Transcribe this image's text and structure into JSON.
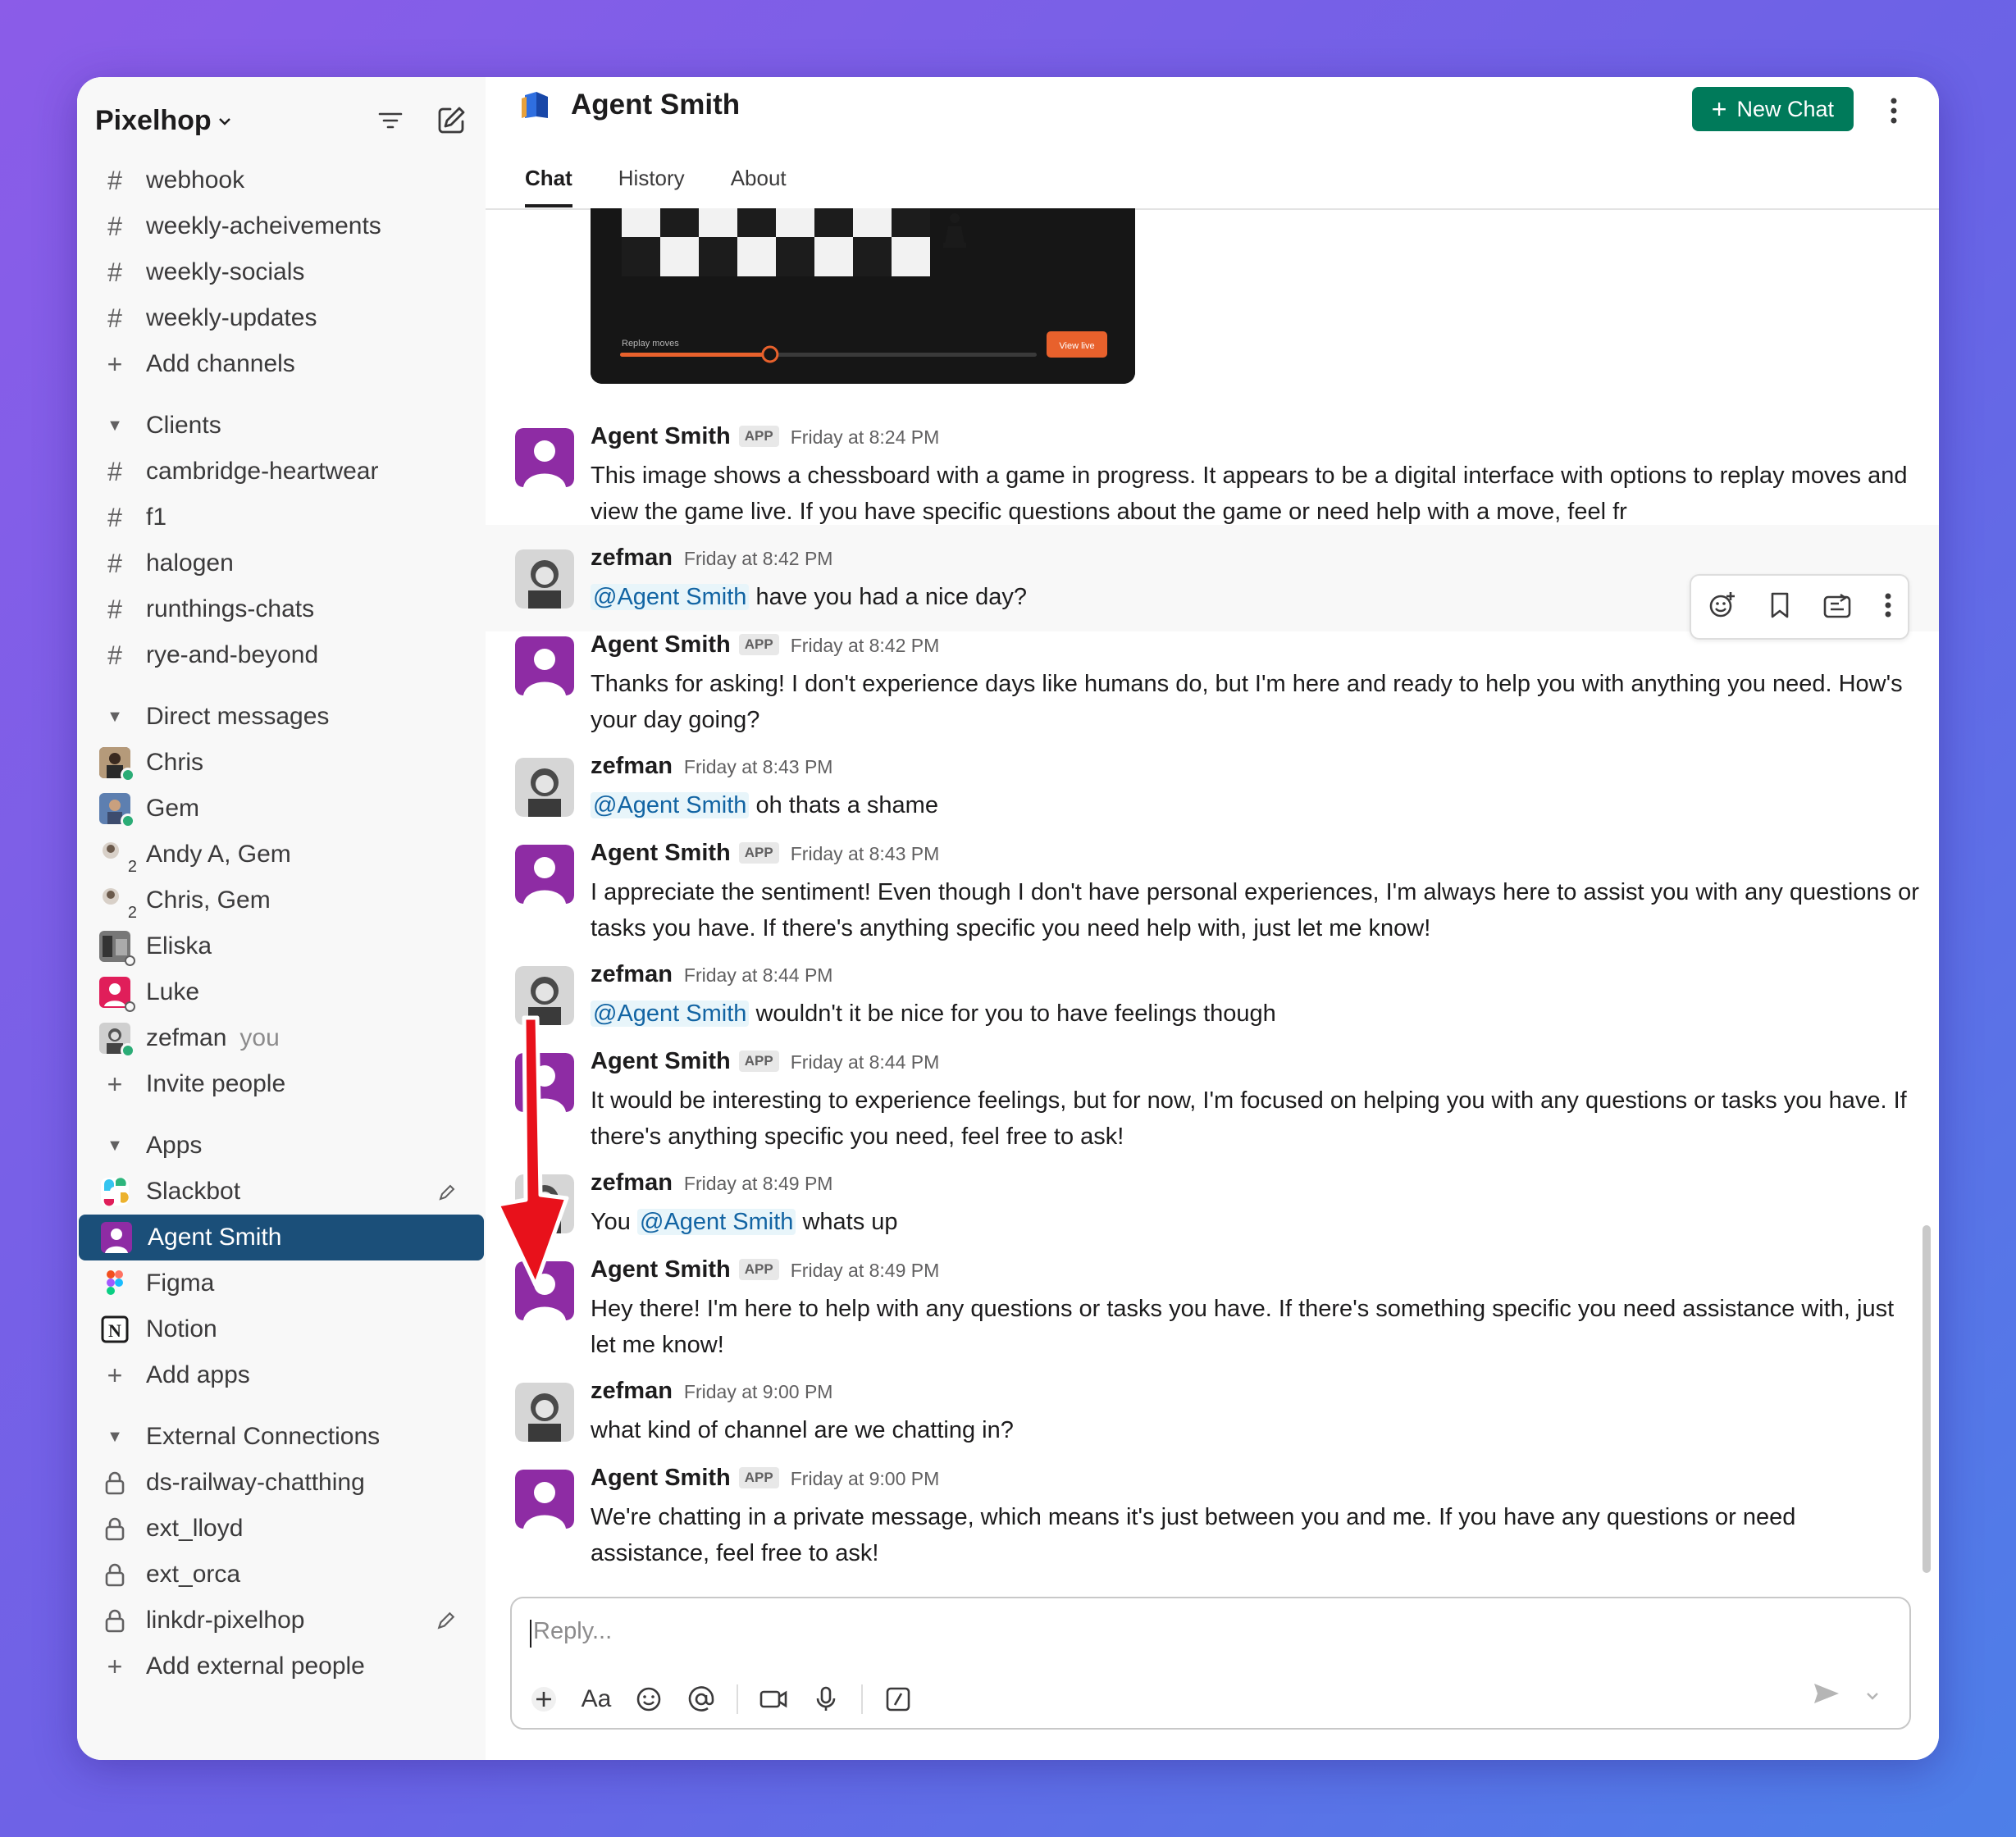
{
  "workspace": {
    "name": "Pixelhop"
  },
  "channels": [
    {
      "label": "webhook"
    },
    {
      "label": "weekly-acheivements"
    },
    {
      "label": "weekly-socials"
    },
    {
      "label": "weekly-updates"
    }
  ],
  "add_channels": "Add channels",
  "clients": {
    "title": "Clients",
    "items": [
      {
        "label": "cambridge-heartwear"
      },
      {
        "label": "f1"
      },
      {
        "label": "halogen"
      },
      {
        "label": "runthings-chats"
      },
      {
        "label": "rye-and-beyond"
      }
    ]
  },
  "dms": {
    "title": "Direct messages",
    "items": [
      {
        "label": "Chris"
      },
      {
        "label": "Gem"
      },
      {
        "label": "Andy A, Gem",
        "count": "2"
      },
      {
        "label": "Chris, Gem",
        "count": "2"
      },
      {
        "label": "Eliska"
      },
      {
        "label": "Luke"
      },
      {
        "label": "zefman",
        "suffix": "you"
      }
    ],
    "invite": "Invite people"
  },
  "apps": {
    "title": "Apps",
    "items": [
      {
        "label": "Slackbot"
      },
      {
        "label": "Agent Smith"
      },
      {
        "label": "Figma"
      },
      {
        "label": "Notion"
      }
    ],
    "add": "Add apps"
  },
  "external": {
    "title": "External Connections",
    "items": [
      {
        "label": "ds-railway-chatthing"
      },
      {
        "label": "ext_lloyd"
      },
      {
        "label": "ext_orca"
      },
      {
        "label": "linkdr-pixelhop"
      }
    ],
    "add": "Add external people"
  },
  "header": {
    "title": "Agent Smith",
    "new_chat": "New Chat",
    "tabs": [
      "Chat",
      "History",
      "About"
    ]
  },
  "chess": {
    "replay_label": "Replay moves",
    "view_live": "View live",
    "replay_progress": 0.36
  },
  "badge": "APP",
  "messages": [
    {
      "author": "Agent Smith",
      "time": "Friday at 8:24 PM",
      "text": "This image shows a chessboard with a game in progress. It appears to be a digital interface with options to replay moves and view the game live. If you have specific questions about the game or need help with a move, feel fr"
    },
    {
      "author": "zefman",
      "time": "Friday at 8:42 PM",
      "mention": "@Agent Smith",
      "text": " have you had a nice day?"
    },
    {
      "author": "Agent Smith",
      "time": "Friday at 8:42 PM",
      "text": "Thanks for asking! I don't experience days like humans do, but I'm here and ready to help you with anything you need. How's your day going?"
    },
    {
      "author": "zefman",
      "time": "Friday at 8:43 PM",
      "mention": "@Agent Smith",
      "text": " oh thats a shame"
    },
    {
      "author": "Agent Smith",
      "time": "Friday at 8:43 PM",
      "text": "I appreciate the sentiment! Even though I don't have personal experiences, I'm always here to assist you with any questions or tasks you have. If there's anything specific you need help with, just let me know!"
    },
    {
      "author": "zefman",
      "time": "Friday at 8:44 PM",
      "mention": "@Agent Smith",
      "text": " wouldn't it be nice for you to have feelings though"
    },
    {
      "author": "Agent Smith",
      "time": "Friday at 8:44 PM",
      "text": "It would be interesting to experience feelings, but for now, I'm focused on helping you with any questions or tasks you have. If there's anything specific you need, feel free to ask!"
    },
    {
      "author": "zefman",
      "time": "Friday at 8:49 PM",
      "prefix": "You ",
      "mention": "@Agent Smith",
      "text": " whats up"
    },
    {
      "author": "Agent Smith",
      "time": "Friday at 8:49 PM",
      "text": "Hey there! I'm here to help with any questions or tasks you have. If there's something specific you need assistance with, just let me know!"
    },
    {
      "author": "zefman",
      "time": "Friday at 9:00 PM",
      "text": "what kind of channel are we chatting in?"
    },
    {
      "author": "Agent Smith",
      "time": "Friday at 9:00 PM",
      "text": "We're chatting in a private message, which means it's just between you and me. If you have any questions or need assistance, feel free to ask!"
    }
  ],
  "composer": {
    "placeholder": "Reply...",
    "format_label": "Aa"
  },
  "colors": {
    "accent": "#1b4f79",
    "new_chat": "#007a5a",
    "mention": "#1264a3",
    "agent_avatar": "#8e2ca4",
    "annotation_arrow": "#e8111b"
  }
}
